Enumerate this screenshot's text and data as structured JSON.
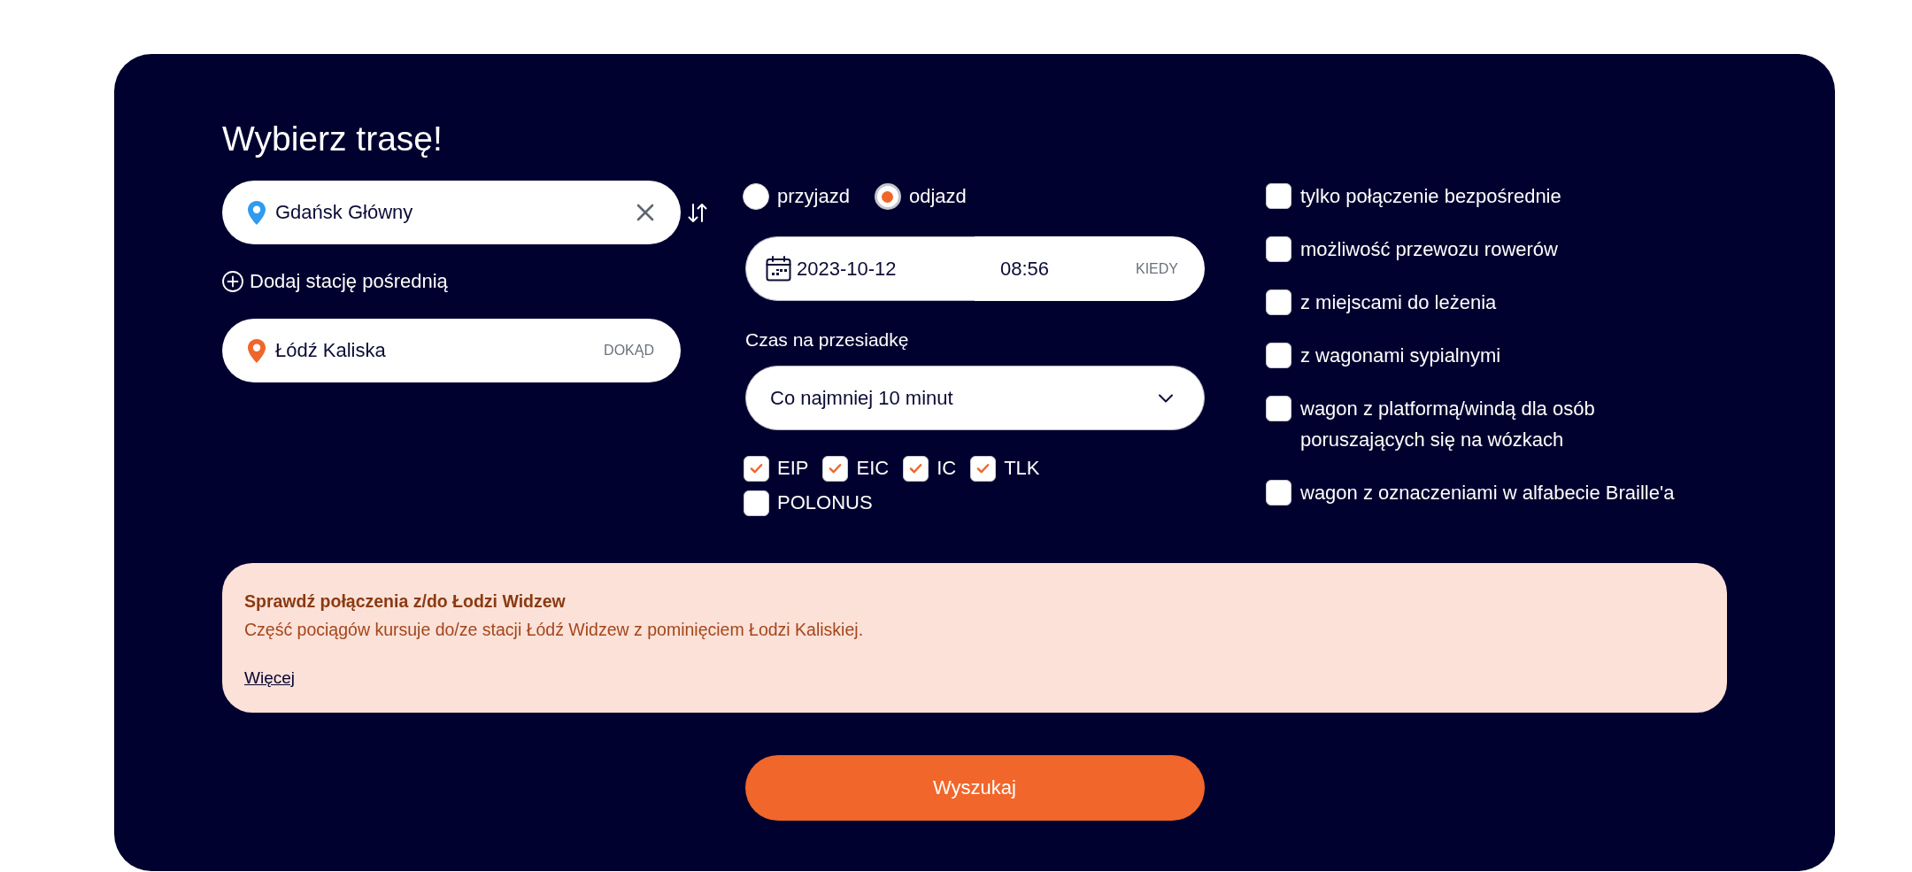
{
  "title": "Wybierz trasę!",
  "route": {
    "from": {
      "value": "Gdańsk Główny"
    },
    "add_via": "Dodaj stację pośrednią",
    "to": {
      "value": "Łódź Kaliska",
      "label": "DOKĄD"
    }
  },
  "direction_options": [
    {
      "label": "przyjazd",
      "selected": false
    },
    {
      "label": "odjazd",
      "selected": true
    }
  ],
  "when": {
    "date": "2023-10-12",
    "time": "08:56",
    "label": "KIEDY"
  },
  "transfer_time": {
    "label": "Czas na przesiadkę",
    "value": "Co najmniej 10 minut"
  },
  "train_categories": [
    {
      "label": "EIP",
      "checked": true
    },
    {
      "label": "EIC",
      "checked": true
    },
    {
      "label": "IC",
      "checked": true
    },
    {
      "label": "TLK",
      "checked": true
    },
    {
      "label": "POLONUS",
      "checked": false
    }
  ],
  "filters": [
    {
      "label": "tylko połączenie bezpośrednie",
      "checked": false
    },
    {
      "label": "możliwość przewozu rowerów",
      "checked": false
    },
    {
      "label": "z miejscami do leżenia",
      "checked": false
    },
    {
      "label": "z wagonami sypialnymi",
      "checked": false
    },
    {
      "label": "wagon z platformą/windą dla osób poruszających się na wózkach",
      "checked": false
    },
    {
      "label": "wagon z oznaczeniami w alfabecie Braille'a",
      "checked": false
    }
  ],
  "notice": {
    "title": "Sprawdź połączenia z/do Łodzi Widzew",
    "text": "Część pociągów kursuje do/ze stacji Łódź Widzew z pominięciem Łodzi Kaliskiej.",
    "link": "Więcej"
  },
  "search_button": "Wyszukaj"
}
